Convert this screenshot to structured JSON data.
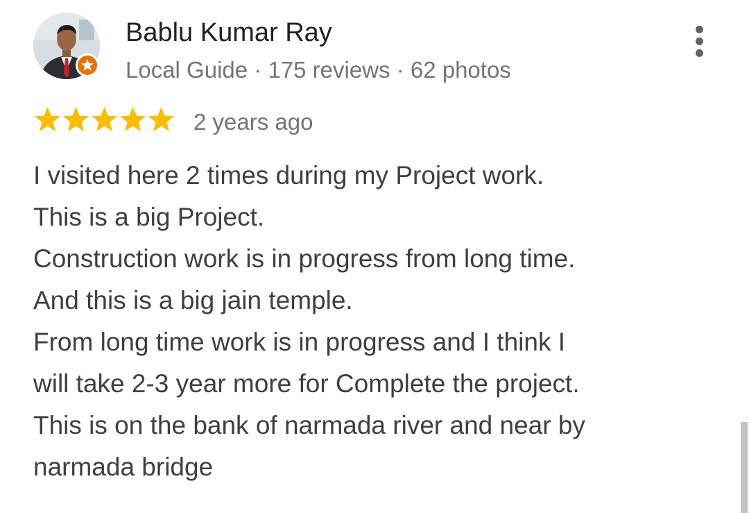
{
  "reviewer": {
    "name": "Bablu Kumar Ray",
    "meta": "Local Guide · 175 reviews · 62 photos",
    "avatar_icon": "user-photo",
    "badge_icon": "local-guide-star-badge",
    "badge_color": "#e8710a"
  },
  "menu": {
    "icon": "more-vert-icon"
  },
  "review": {
    "rating": 5,
    "rating_max": 5,
    "star_color": "#fbbc04",
    "date": "2 years ago",
    "lines": [
      "I visited here 2 times during my Project work.",
      "This is a big Project.",
      "Construction work is in progress from long time.",
      "And this is a big jain temple.",
      "From long time work is in progress and I think I",
      "will take 2-3 year more for Complete the project.",
      "This is on the bank of narmada river and near by",
      "narmada bridge"
    ]
  }
}
